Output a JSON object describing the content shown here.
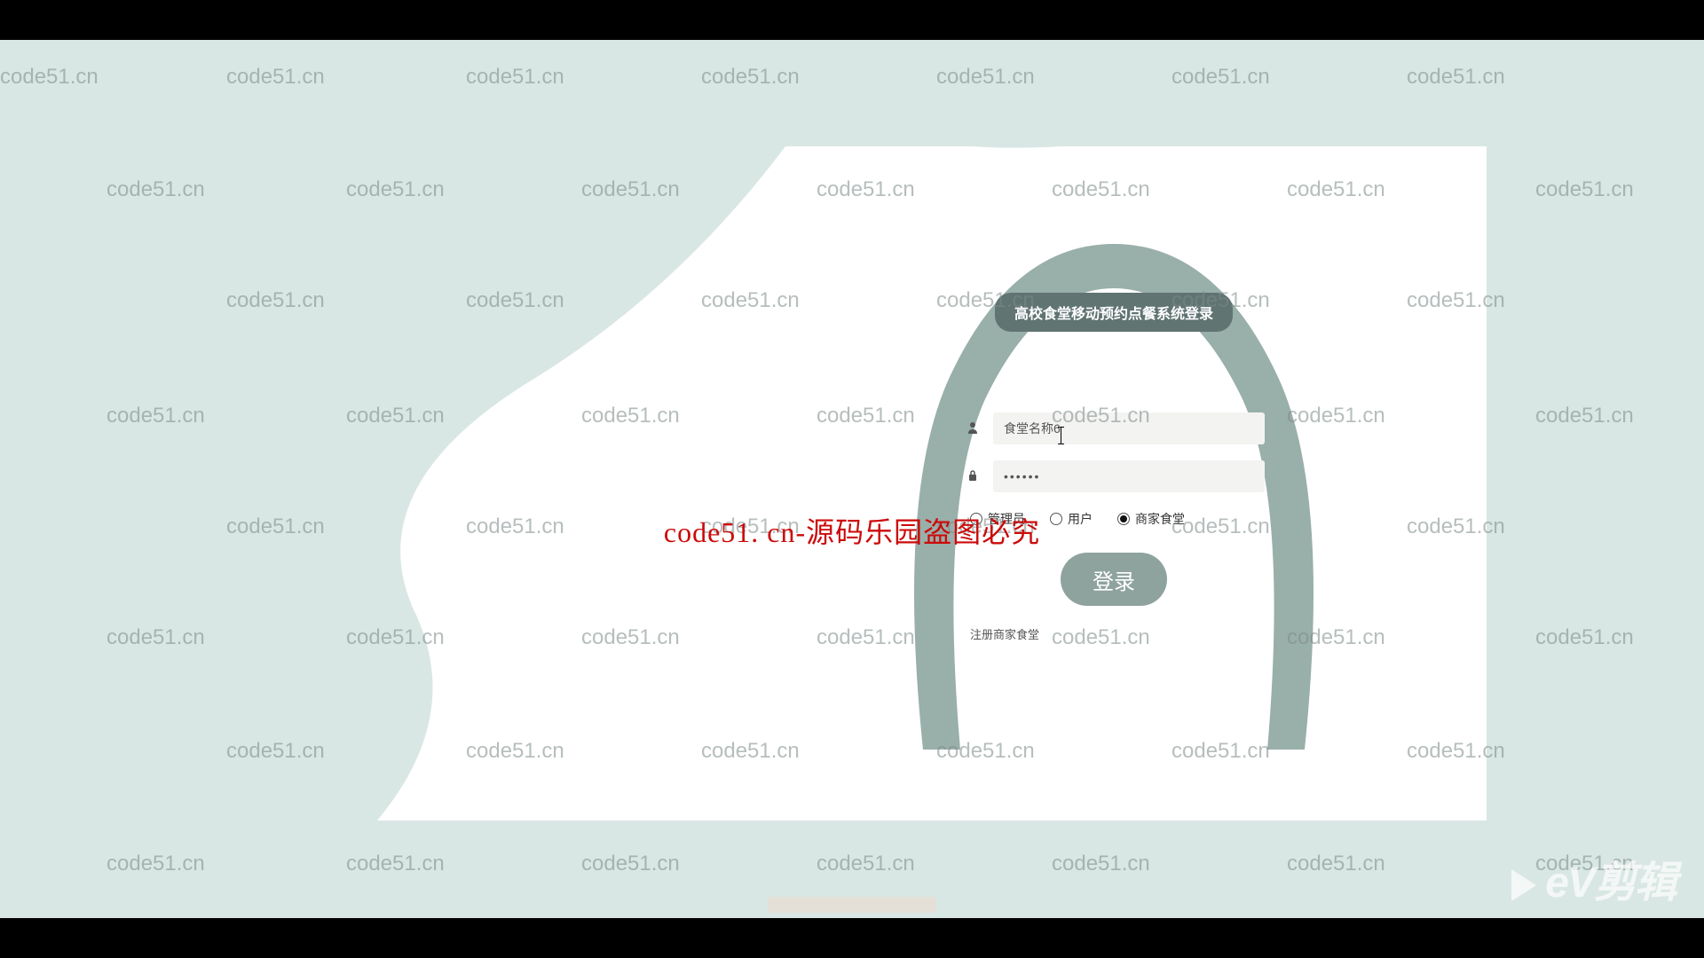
{
  "watermark_text": "code51.cn",
  "center_watermark": "code51. cn-源码乐园盗图必究",
  "login": {
    "title": "高校食堂移动预约点餐系统登录",
    "username_value": "食堂名称6",
    "password_value": "••••••",
    "roles": {
      "admin": "管理员",
      "user": "用户",
      "merchant": "商家食堂"
    },
    "selected_role": "merchant",
    "login_button": "登录",
    "register_link": "注册商家食堂"
  },
  "ev_logo": "eV剪辑"
}
